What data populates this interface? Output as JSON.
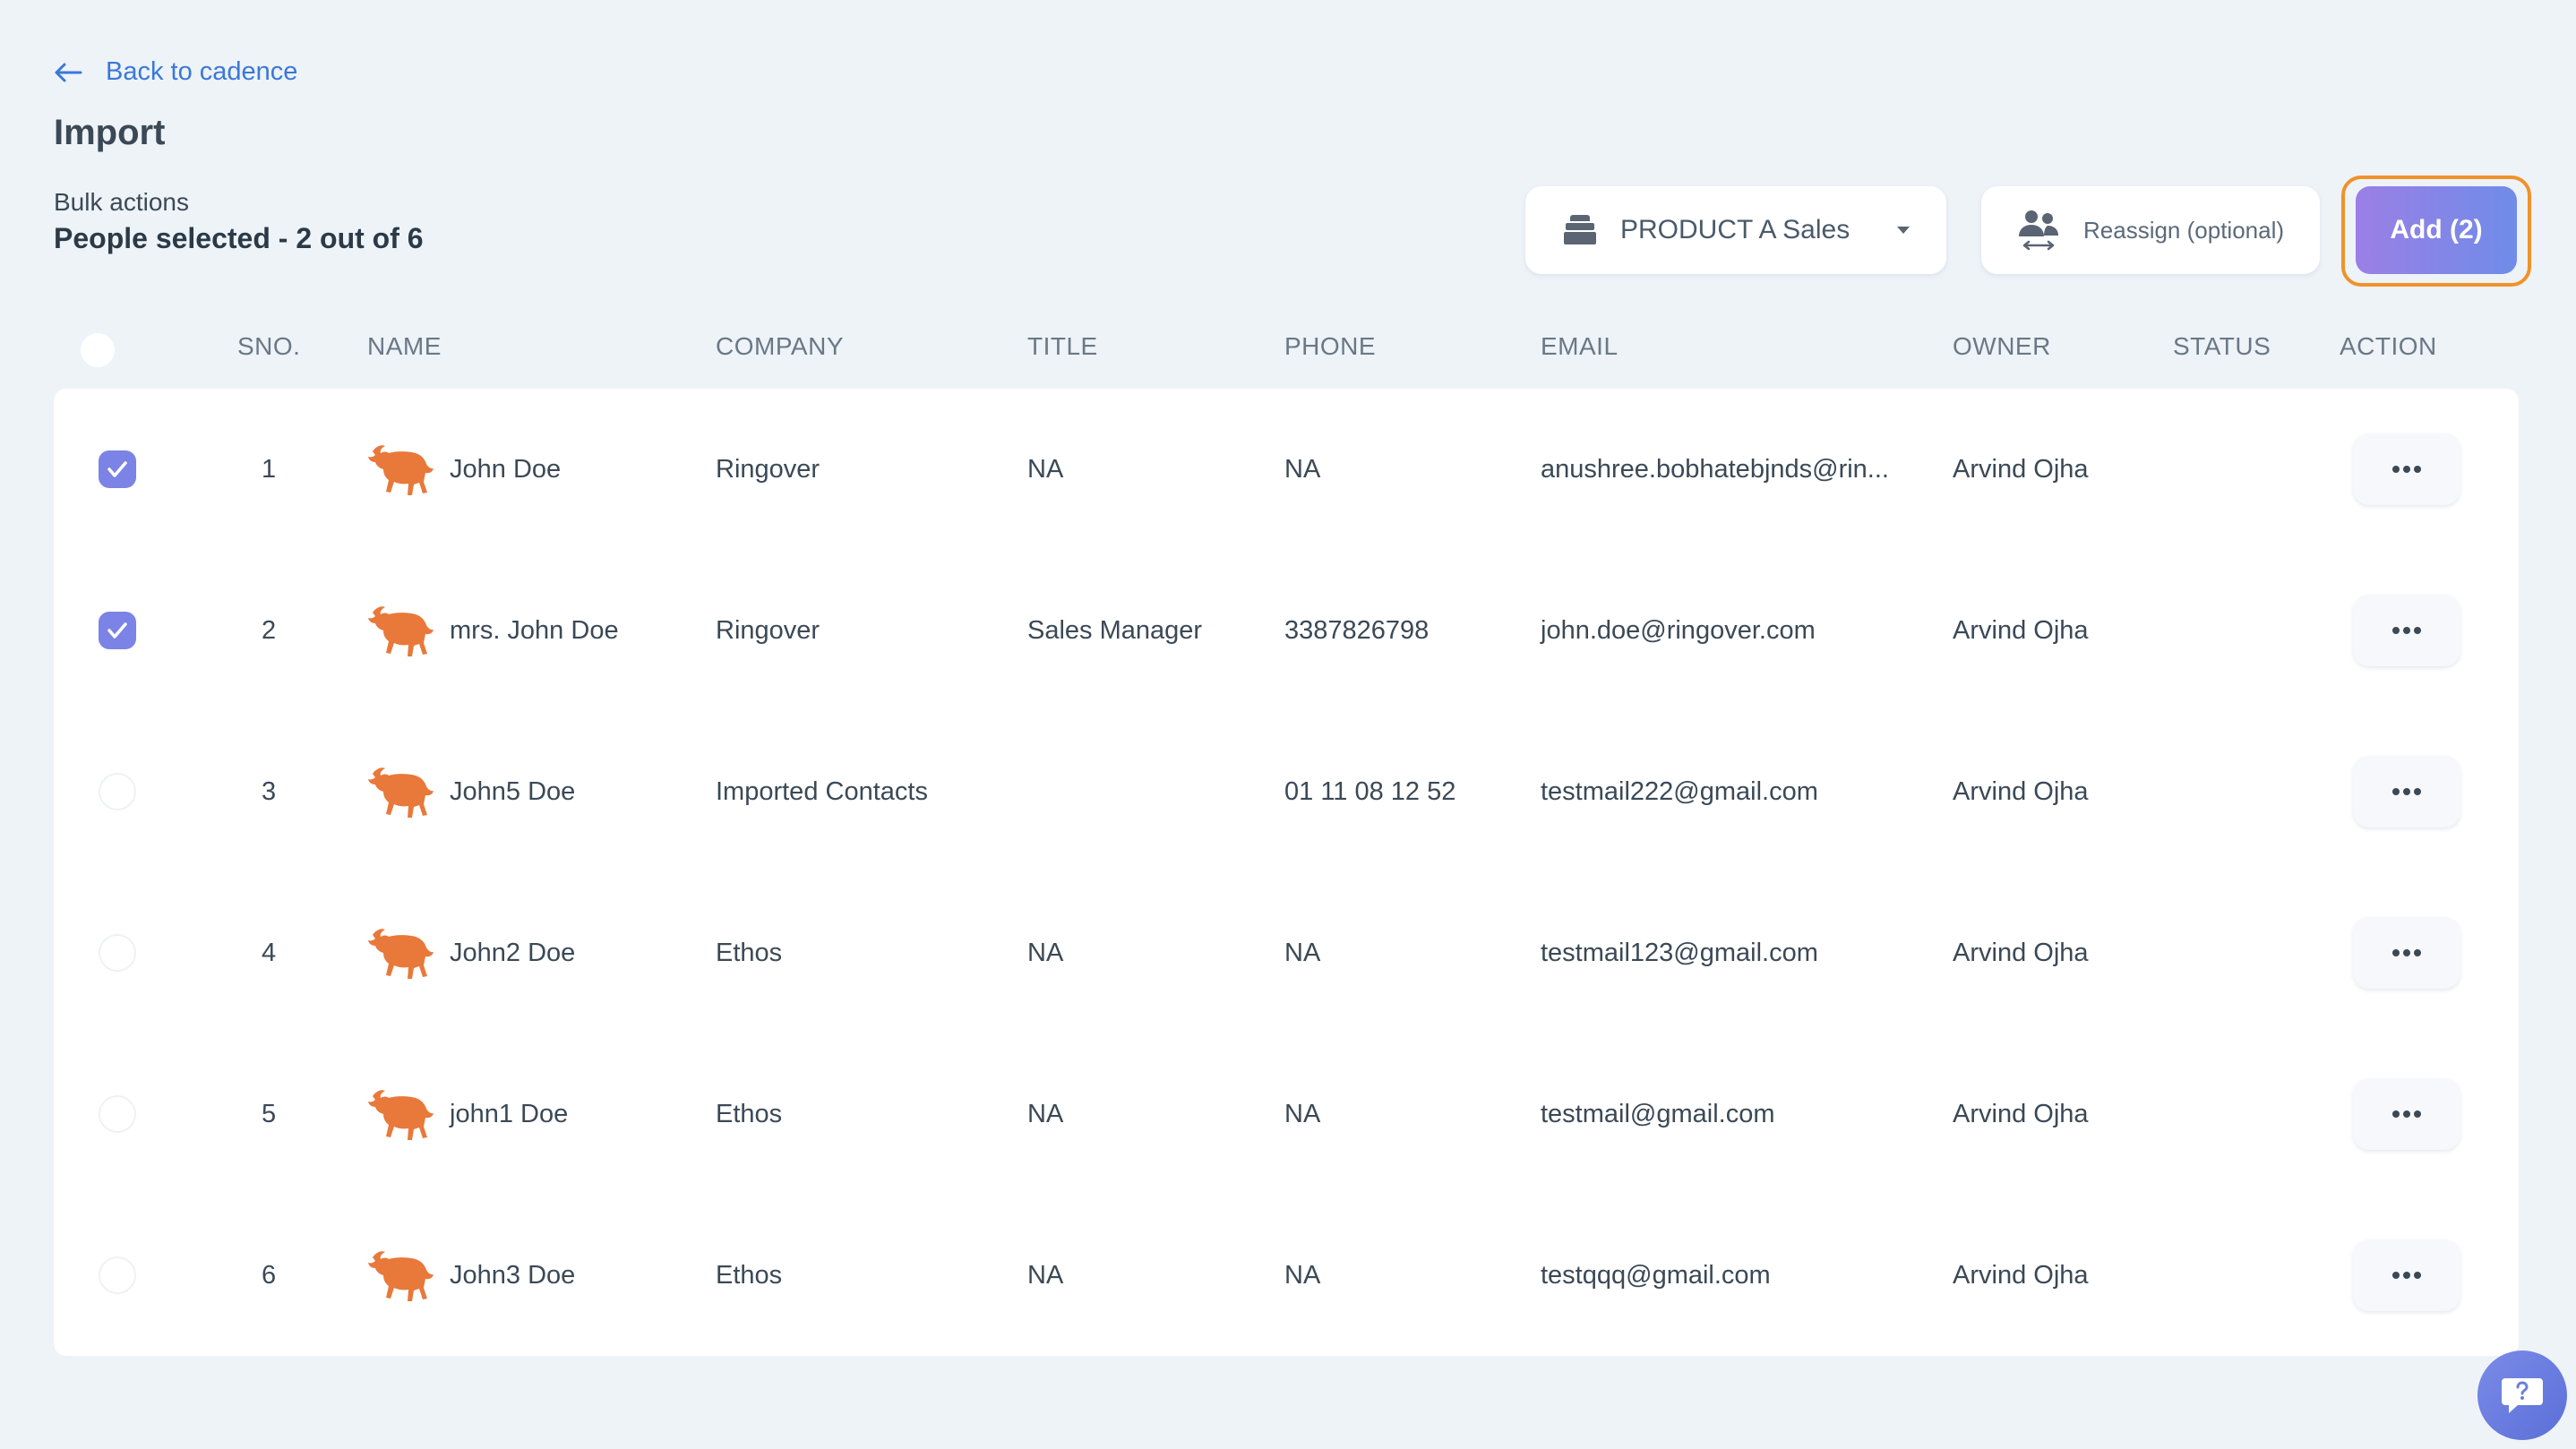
{
  "nav": {
    "back_label": "Back to cadence"
  },
  "page": {
    "title": "Import"
  },
  "bulk": {
    "label": "Bulk actions",
    "selected_text": "People selected - 2 out of 6"
  },
  "toolbar": {
    "product_select": "PRODUCT A Sales",
    "reassign_label": "Reassign (optional)",
    "add_label": "Add (2)"
  },
  "table": {
    "headers": [
      "SNO.",
      "NAME",
      "COMPANY",
      "TITLE",
      "PHONE",
      "EMAIL",
      "OWNER",
      "STATUS",
      "ACTION"
    ],
    "rows": [
      {
        "checked": true,
        "sno": "1",
        "name": "John Doe",
        "company": "Ringover",
        "title": "NA",
        "phone": "NA",
        "email": "anushree.bobhatebjnds@rin...",
        "owner": "Arvind Ojha",
        "status": ""
      },
      {
        "checked": true,
        "sno": "2",
        "name": "mrs. John Doe",
        "company": "Ringover",
        "title": "Sales Manager",
        "phone": "3387826798",
        "email": "john.doe@ringover.com",
        "owner": "Arvind Ojha",
        "status": ""
      },
      {
        "checked": false,
        "sno": "3",
        "name": "John5 Doe",
        "company": "Imported Contacts",
        "title": "",
        "phone": "01 11 08 12 52",
        "email": "testmail222@gmail.com",
        "owner": "Arvind Ojha",
        "status": ""
      },
      {
        "checked": false,
        "sno": "4",
        "name": "John2 Doe",
        "company": "Ethos",
        "title": "NA",
        "phone": "NA",
        "email": "testmail123@gmail.com",
        "owner": "Arvind Ojha",
        "status": ""
      },
      {
        "checked": false,
        "sno": "5",
        "name": "john1 Doe",
        "company": "Ethos",
        "title": "NA",
        "phone": "NA",
        "email": "testmail@gmail.com",
        "owner": "Arvind Ojha",
        "status": ""
      },
      {
        "checked": false,
        "sno": "6",
        "name": "John3 Doe",
        "company": "Ethos",
        "title": "NA",
        "phone": "NA",
        "email": "testqqq@gmail.com",
        "owner": "Arvind Ojha",
        "status": ""
      }
    ]
  },
  "colors": {
    "accent": "#3a78d8",
    "checkbox": "#7b83e6",
    "brand_orange": "#e8793a",
    "add_outline": "#f0922a"
  },
  "icons": {
    "back": "arrow-left-icon",
    "product": "stack-icon",
    "caret": "caret-down-icon",
    "reassign": "users-swap-icon",
    "avatar": "bull-icon",
    "action": "more-horizontal-icon",
    "chat": "help-chat-icon"
  }
}
